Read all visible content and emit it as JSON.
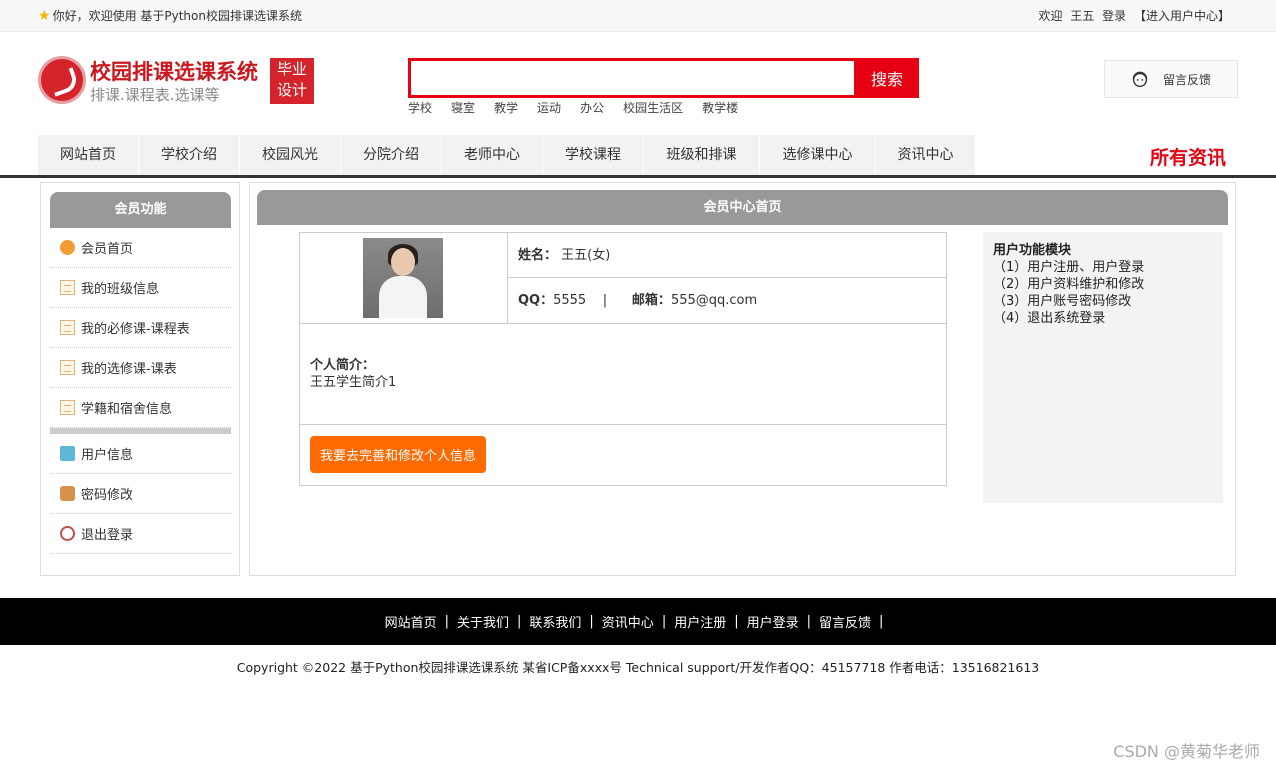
{
  "topbar": {
    "greeting": "你好，欢迎使用 基于Python校园排课选课系统",
    "welcome": "欢迎",
    "user": "王五",
    "login": "登录",
    "center": "【进入用户中心】"
  },
  "logo": {
    "title": "校园排课选课系统",
    "subtitle": "排课.课程表.选课等",
    "badge_line1": "毕业",
    "badge_line2": "设计"
  },
  "search": {
    "button": "搜索",
    "value": "",
    "hotwords": [
      "学校",
      "寝室",
      "教学",
      "运动",
      "办公",
      "校园生活区",
      "教学楼"
    ]
  },
  "feedback": {
    "label": "留言反馈"
  },
  "nav": {
    "items": [
      "网站首页",
      "学校介绍",
      "校园风光",
      "分院介绍",
      "老师中心",
      "学校课程",
      "班级和排课",
      "选修课中心",
      "资讯中心"
    ],
    "right": "所有资讯"
  },
  "sidebar": {
    "title": "会员功能",
    "items": [
      {
        "label": "会员首页",
        "icon": "home-icon"
      },
      {
        "label": "我的班级信息",
        "icon": "document-icon"
      },
      {
        "label": "我的必修课-课程表",
        "icon": "document-icon"
      },
      {
        "label": "我的选修课-课表",
        "icon": "document-icon"
      },
      {
        "label": "学籍和宿舍信息",
        "icon": "document-icon"
      }
    ],
    "items2": [
      {
        "label": "用户信息",
        "icon": "user-icon"
      },
      {
        "label": "密码修改",
        "icon": "lock-icon"
      },
      {
        "label": "退出登录",
        "icon": "power-icon"
      }
    ]
  },
  "main": {
    "title": "会员中心首页",
    "name_label": "姓名：",
    "name_value": "王五(女)",
    "qq_label": "QQ：",
    "qq_value": "5555",
    "divider": "|",
    "email_label": "邮箱：",
    "email_value": "555@qq.com",
    "intro_label": "个人简介：",
    "intro_value": "王五学生简介1",
    "edit_button": "我要去完善和修改个人信息"
  },
  "func": {
    "title": "用户功能模块",
    "items": [
      "（1）用户注册、用户登录",
      "（2）用户资料维护和修改",
      "（3）用户账号密码修改",
      "（4）退出系统登录"
    ]
  },
  "footer": {
    "links": [
      "网站首页",
      "关于我们",
      "联系我们",
      "资讯中心",
      "用户注册",
      "用户登录",
      "留言反馈"
    ],
    "sep": "|",
    "copyright": "Copyright ©2022 基于Python校园排课选课系统 某省ICP备xxxx号    Technical support/开发作者QQ：45157718     作者电话：13516821613"
  },
  "watermark": "CSDN @黄菊华老师",
  "colors": {
    "accent": "#e60012",
    "brand": "#c9191f",
    "button": "#ff6a00",
    "header_gray": "#999999"
  }
}
